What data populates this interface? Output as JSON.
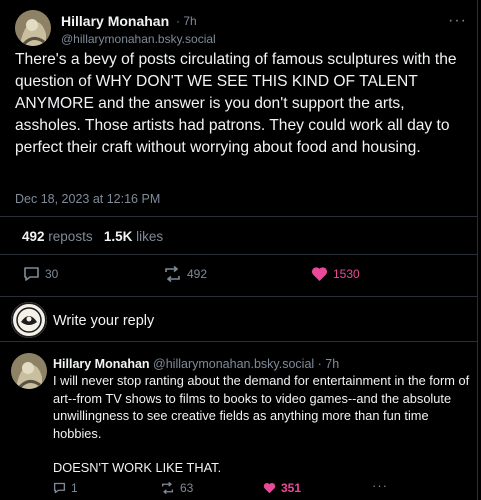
{
  "post": {
    "author_name": "Hillary Monahan",
    "time_ago": "· 7h",
    "handle": "@hillarymonahan.bsky.social",
    "more_label": "···",
    "text": "There's a bevy of posts circulating of famous sculptures with the question of WHY DON'T WE SEE THIS KIND OF TALENT ANYMORE and the answer is you don't support the arts, assholes.  Those artists had patrons. They could work all day to perfect their craft without worrying about food and housing.",
    "timestamp": "Dec 18, 2023 at 12:16 PM",
    "reposts_count": "492",
    "reposts_label": "reposts",
    "likes_count": "1.5K",
    "likes_label": "likes",
    "actions": {
      "replies": "30",
      "reposts": "492",
      "likes": "1530"
    }
  },
  "composer": {
    "placeholder": "Write your reply"
  },
  "reply": {
    "author_name": "Hillary Monahan",
    "handle_time": "@hillarymonahan.bsky.social · 7h",
    "text_1": "I will never stop ranting about the demand for entertainment in the form of art--from TV shows to films to books to video games--and the absolute unwillingness to see creative fields as anything more than fun time hobbies.",
    "text_2": "DOESN'T WORK LIKE THAT.",
    "actions": {
      "replies": "1",
      "reposts": "63",
      "likes": "351",
      "more": "···"
    }
  },
  "colors": {
    "background": "#000000",
    "text": "#f1f3f5",
    "muted": "#7f8b98",
    "like_active": "#ec4899",
    "divider": "#2a2f36"
  }
}
